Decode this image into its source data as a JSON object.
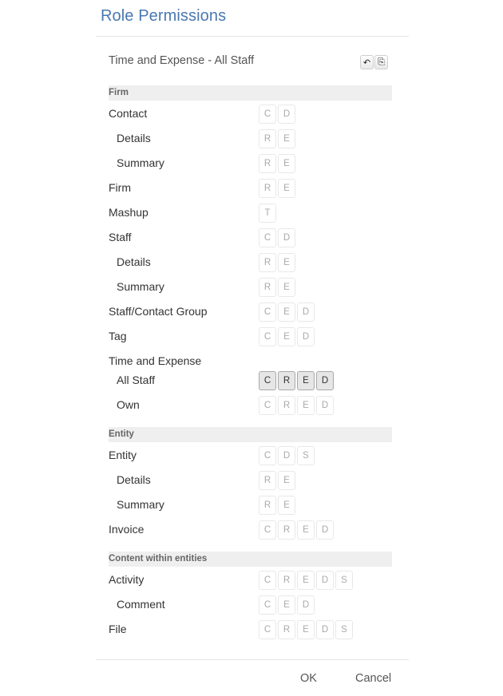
{
  "dialog": {
    "title": "Role Permissions",
    "subtitle": "Time and Expense - All Staff",
    "tools": [
      {
        "icon": "undo-icon",
        "glyph": "↶"
      },
      {
        "icon": "copy-icon",
        "glyph": "⎘"
      }
    ],
    "ok_label": "OK",
    "cancel_label": "Cancel"
  },
  "sections": [
    {
      "header": "Firm",
      "rows": [
        {
          "label": "Contact",
          "sub": false,
          "perms": [
            {
              "t": "C",
              "on": false
            },
            {
              "t": "D",
              "on": false
            }
          ]
        },
        {
          "label": "Details",
          "sub": true,
          "perms": [
            {
              "t": "R",
              "on": false
            },
            {
              "t": "E",
              "on": false
            }
          ]
        },
        {
          "label": "Summary",
          "sub": true,
          "perms": [
            {
              "t": "R",
              "on": false
            },
            {
              "t": "E",
              "on": false
            }
          ]
        },
        {
          "label": "Firm",
          "sub": false,
          "perms": [
            {
              "t": "R",
              "on": false
            },
            {
              "t": "E",
              "on": false
            }
          ]
        },
        {
          "label": "Mashup",
          "sub": false,
          "perms": [
            {
              "t": "T",
              "on": false
            }
          ]
        },
        {
          "label": "Staff",
          "sub": false,
          "perms": [
            {
              "t": "C",
              "on": false
            },
            {
              "t": "D",
              "on": false
            }
          ]
        },
        {
          "label": "Details",
          "sub": true,
          "perms": [
            {
              "t": "R",
              "on": false
            },
            {
              "t": "E",
              "on": false
            }
          ]
        },
        {
          "label": "Summary",
          "sub": true,
          "perms": [
            {
              "t": "R",
              "on": false
            },
            {
              "t": "E",
              "on": false
            }
          ]
        },
        {
          "label": "Staff/Contact Group",
          "sub": false,
          "perms": [
            {
              "t": "C",
              "on": false
            },
            {
              "t": "E",
              "on": false
            },
            {
              "t": "D",
              "on": false
            }
          ]
        },
        {
          "label": "Tag",
          "sub": false,
          "perms": [
            {
              "t": "C",
              "on": false
            },
            {
              "t": "E",
              "on": false
            },
            {
              "t": "D",
              "on": false
            }
          ]
        },
        {
          "label": "Time and Expense",
          "sub": false,
          "perms": []
        },
        {
          "label": "All Staff",
          "sub": true,
          "perms": [
            {
              "t": "C",
              "on": true
            },
            {
              "t": "R",
              "on": true
            },
            {
              "t": "E",
              "on": true
            },
            {
              "t": "D",
              "on": true
            }
          ]
        },
        {
          "label": "Own",
          "sub": true,
          "perms": [
            {
              "t": "C",
              "on": false
            },
            {
              "t": "R",
              "on": false
            },
            {
              "t": "E",
              "on": false
            },
            {
              "t": "D",
              "on": false
            }
          ]
        }
      ]
    },
    {
      "header": "Entity",
      "rows": [
        {
          "label": "Entity",
          "sub": false,
          "perms": [
            {
              "t": "C",
              "on": false
            },
            {
              "t": "D",
              "on": false
            },
            {
              "t": "S",
              "on": false
            }
          ]
        },
        {
          "label": "Details",
          "sub": true,
          "perms": [
            {
              "t": "R",
              "on": false
            },
            {
              "t": "E",
              "on": false
            }
          ]
        },
        {
          "label": "Summary",
          "sub": true,
          "perms": [
            {
              "t": "R",
              "on": false
            },
            {
              "t": "E",
              "on": false
            }
          ]
        },
        {
          "label": "Invoice",
          "sub": false,
          "perms": [
            {
              "t": "C",
              "on": false
            },
            {
              "t": "R",
              "on": false
            },
            {
              "t": "E",
              "on": false
            },
            {
              "t": "D",
              "on": false
            }
          ]
        }
      ]
    },
    {
      "header": "Content within entities",
      "rows": [
        {
          "label": "Activity",
          "sub": false,
          "perms": [
            {
              "t": "C",
              "on": false
            },
            {
              "t": "R",
              "on": false
            },
            {
              "t": "E",
              "on": false
            },
            {
              "t": "D",
              "on": false
            },
            {
              "t": "S",
              "on": false
            }
          ]
        },
        {
          "label": "Comment",
          "sub": true,
          "perms": [
            {
              "t": "C",
              "on": false
            },
            {
              "t": "E",
              "on": false
            },
            {
              "t": "D",
              "on": false
            }
          ]
        },
        {
          "label": "File",
          "sub": false,
          "perms": [
            {
              "t": "C",
              "on": false
            },
            {
              "t": "R",
              "on": false
            },
            {
              "t": "E",
              "on": false
            },
            {
              "t": "D",
              "on": false
            },
            {
              "t": "S",
              "on": false
            }
          ]
        }
      ]
    }
  ]
}
